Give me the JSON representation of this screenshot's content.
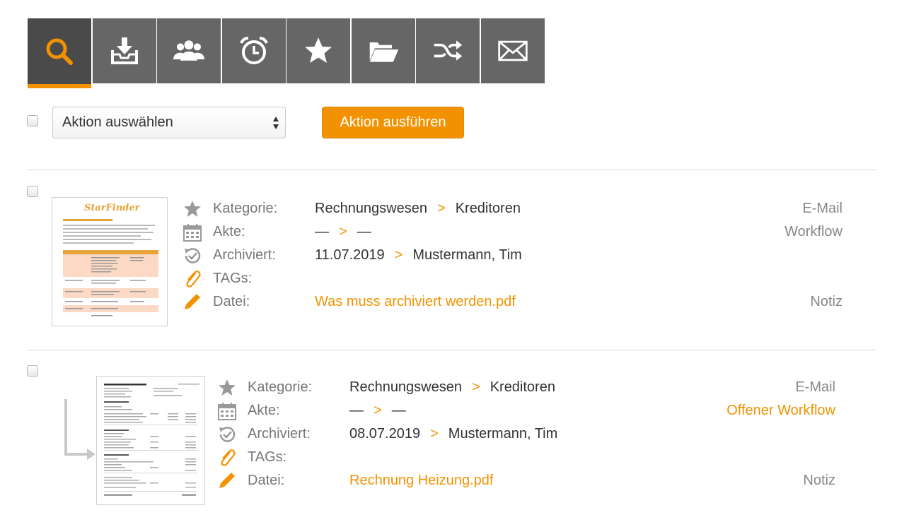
{
  "toolbar": {
    "buttons": [
      {
        "icon": "search-icon",
        "active": true
      },
      {
        "icon": "inbox-download-icon"
      },
      {
        "icon": "users-icon"
      },
      {
        "icon": "alarm-clock-icon"
      },
      {
        "icon": "star-icon"
      },
      {
        "icon": "folder-open-icon"
      },
      {
        "icon": "shuffle-icon"
      },
      {
        "icon": "envelope-icon"
      }
    ],
    "active_color": "#f39200"
  },
  "actions": {
    "select_value": "Aktion auswählen",
    "run_label": "Aktion ausführen"
  },
  "labels": {
    "category": "Kategorie:",
    "file_record": "Akte:",
    "archived": "Archiviert:",
    "tags": "TAGs:",
    "file": "Datei:"
  },
  "documents": [
    {
      "category": "Rechnungswesen",
      "subcategory": "Kreditoren",
      "file_record_a": "—",
      "file_record_b": "—",
      "archived_date": "11.07.2019",
      "archived_by": "Mustermann, Tim",
      "tags": "",
      "filename": "Was muss archiviert werden.pdf",
      "email_label": "E-Mail",
      "workflow_label": "Workflow",
      "note_label": "Notiz",
      "thumb_title": "StarFinder"
    },
    {
      "category": "Rechnungswesen",
      "subcategory": "Kreditoren",
      "file_record_a": "—",
      "file_record_b": "—",
      "archived_date": "08.07.2019",
      "archived_by": "Mustermann, Tim",
      "tags": "",
      "filename": "Rechnung Heizung.pdf",
      "email_label": "E-Mail",
      "workflow_label": "Offener Workflow",
      "note_label": "Notiz"
    }
  ],
  "separator": ">"
}
